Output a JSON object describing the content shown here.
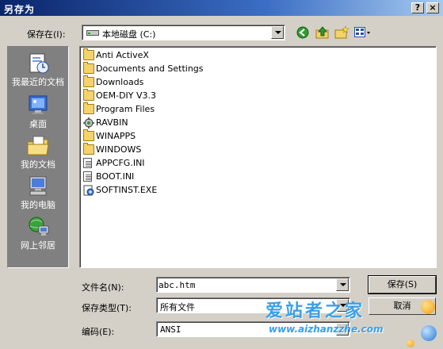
{
  "window": {
    "title": "另存为",
    "help_label": "?",
    "close_label": "×"
  },
  "toolbar": {
    "save_in_label": "保存在(I):",
    "location": "本地磁盘 (C:)",
    "tools": [
      "back-icon",
      "up-folder-icon",
      "new-folder-icon",
      "view-menu-icon"
    ]
  },
  "places": [
    {
      "label": "我最近的文档",
      "icon": "recent-documents-icon"
    },
    {
      "label": "桌面",
      "icon": "desktop-icon"
    },
    {
      "label": "我的文档",
      "icon": "my-documents-icon"
    },
    {
      "label": "我的电脑",
      "icon": "my-computer-icon"
    },
    {
      "label": "网上邻居",
      "icon": "network-places-icon"
    }
  ],
  "files": [
    {
      "name": "Anti ActiveX",
      "type": "folder"
    },
    {
      "name": "Documents and Settings",
      "type": "folder"
    },
    {
      "name": "Downloads",
      "type": "folder"
    },
    {
      "name": "OEM-DIY V3.3",
      "type": "folder"
    },
    {
      "name": "Program Files",
      "type": "folder"
    },
    {
      "name": "RAVBIN",
      "type": "special-folder"
    },
    {
      "name": "WINAPPS",
      "type": "folder"
    },
    {
      "name": "WINDOWS",
      "type": "folder"
    },
    {
      "name": "APPCFG.INI",
      "type": "ini"
    },
    {
      "name": "BOOT.INI",
      "type": "ini"
    },
    {
      "name": "SOFTINST.EXE",
      "type": "exe"
    }
  ],
  "form": {
    "filename_label": "文件名(N):",
    "filename_value": "abc.htm",
    "filetype_label": "保存类型(T):",
    "filetype_value": "所有文件",
    "encoding_label": "编码(E):",
    "encoding_value": "ANSI"
  },
  "buttons": {
    "save": "保存(S)",
    "cancel": "取消"
  },
  "watermark": {
    "text": "爱站者之家",
    "url": "www.aizhanzzhe.com"
  },
  "colors": {
    "titlebar": "#0a246a",
    "face": "#d4d0c8",
    "places_bg": "#808080",
    "watermark": "#3aa0e8"
  }
}
